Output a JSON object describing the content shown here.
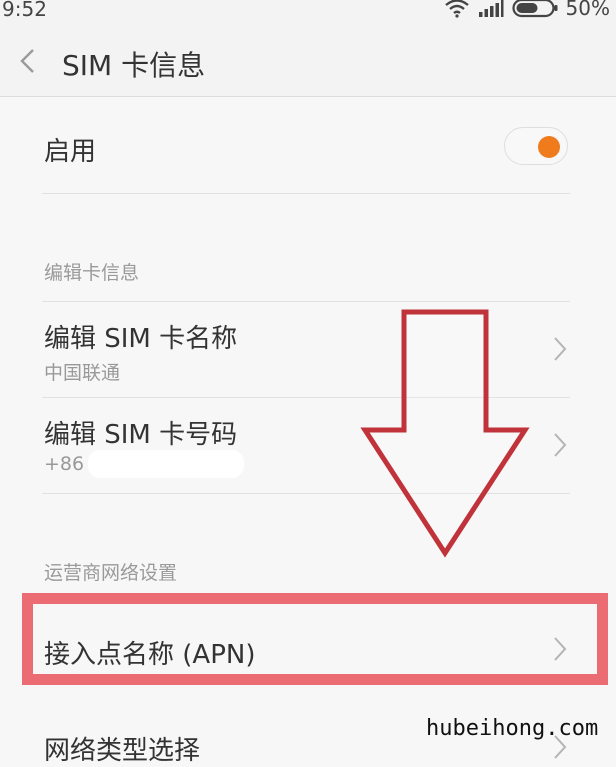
{
  "status_bar": {
    "time": "9:52",
    "battery": "50%",
    "icons": [
      "wifi-icon",
      "signal-icon",
      "battery-icon"
    ]
  },
  "header": {
    "back_icon": "chevron-left-icon",
    "title": "SIM 卡信息"
  },
  "enable_row": {
    "label": "启用",
    "toggle_on": true,
    "toggle_color": "#f07b1c"
  },
  "edit_section": {
    "header": "编辑卡信息",
    "items": [
      {
        "label": "编辑 SIM 卡名称",
        "sub": "中国联通"
      },
      {
        "label": "编辑 SIM 卡号码",
        "sub": "+86"
      }
    ]
  },
  "network_section": {
    "header": "运营商网络设置",
    "items": [
      {
        "label": "接入点名称 (APN)",
        "highlighted": true,
        "highlight_color": "#eb6c73"
      },
      {
        "label": "网络类型选择"
      }
    ]
  },
  "annotation": {
    "arrow_color": "#c0333b",
    "arrow_direction": "down"
  },
  "watermark": "hubeihong.com"
}
